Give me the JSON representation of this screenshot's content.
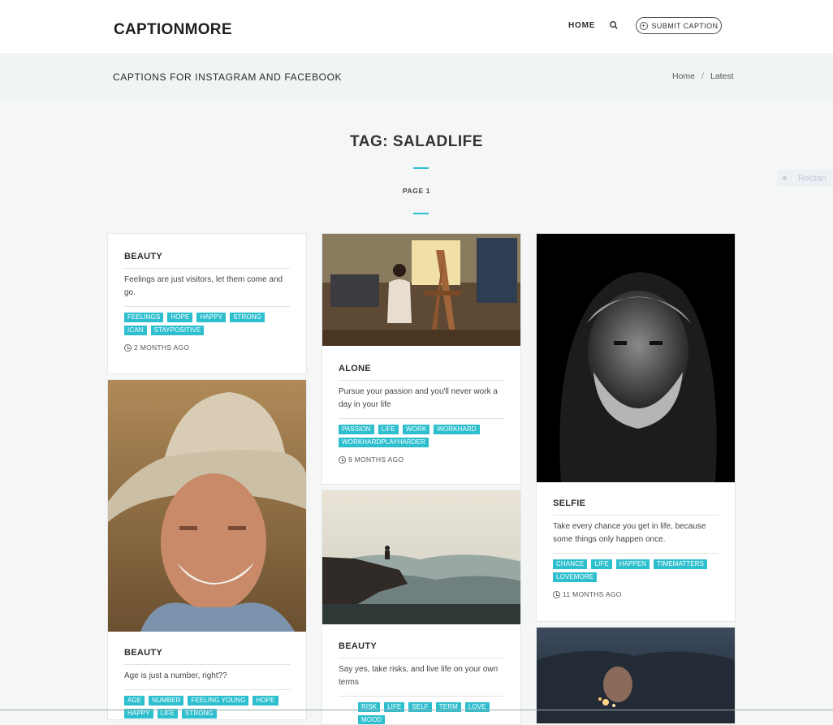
{
  "header": {
    "logo": "CAPTIONMORE",
    "nav_home": "HOME",
    "submit_label": "SUBMIT CAPTION"
  },
  "subbar": {
    "title": "CAPTIONS FOR INSTAGRAM AND FACEBOOK",
    "breadcrumb": [
      "Home",
      "Latest"
    ]
  },
  "page": {
    "heading": "TAG: SALADLIFE",
    "page_label": "PAGE 1"
  },
  "ghost_pill": {
    "label": "Rectan"
  },
  "colors": {
    "accent": "#2ebfcf",
    "background": "#f5f6f6"
  },
  "cards": [
    {
      "category": "BEAUTY",
      "text": "Feelings are just visitors, let them come and go.",
      "tags": [
        "FEELINGS",
        "HOPE",
        "HAPPY",
        "STRONG",
        "ICAN",
        "STAYPOSITIVE"
      ],
      "time": "2 MONTHS AGO"
    },
    {
      "category": "BEAUTY",
      "text": "Age is just a number, right??",
      "tags": [
        "AGE",
        "NUMBER",
        "FEELING YOUNG",
        "HOPE",
        "HAPPY",
        "LIFE",
        "STRONG"
      ]
    },
    {
      "category": "ALONE",
      "text": "Pursue your passion and you'll never work a day in your life",
      "tags": [
        "PASSION",
        "LIFE",
        "WORK",
        "WORKHARD",
        "WORKHARDPLAYHARDER"
      ],
      "time": "9 MONTHS AGO"
    },
    {
      "category": "BEAUTY",
      "text": "Say yes, take risks, and live life on your own terms",
      "tags": [
        "RISK",
        "LIFE",
        "SELF",
        "TERM",
        "LOVE",
        "MOOD"
      ]
    },
    {
      "category": "SELFIE",
      "text": "Take every chance you get in life, because some things only happen once.",
      "tags": [
        "CHANCE",
        "LIFE",
        "HAPPEN",
        "TIMEMATTERS",
        "LOVEMORE"
      ],
      "time": "11 MONTHS AGO"
    }
  ]
}
